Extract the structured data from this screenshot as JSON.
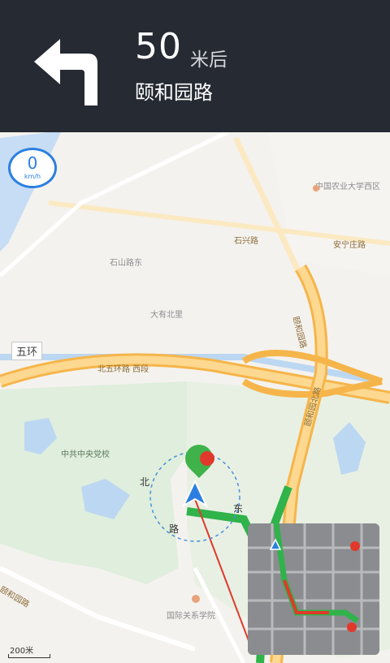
{
  "nav": {
    "distance": "50",
    "distance_unit": "米后",
    "road_name": "颐和园路",
    "turn_direction": "left-turn-icon"
  },
  "speed": {
    "value": "0",
    "unit": "km/h"
  },
  "map": {
    "ring_label": "五环",
    "labels": {
      "top_right_poi": "中国农业大学西区",
      "area1": "石山路东",
      "area2": "大有北里",
      "road_fifth_ring": "北五环路 西段",
      "road_right_vertical": "颐和园路",
      "road_right_vertical2": "颐和园北路",
      "park": "中共中央党校",
      "route_label_left": "北",
      "route_label_right": "东",
      "route_label_bottom": "路",
      "bottom_poi": "国际关系学院",
      "bottom_left_road": "颐和园路",
      "road_top": "石兴路",
      "right_road": "安宁庄路"
    },
    "scale": "200米"
  },
  "colors": {
    "header_bg": "#252a33",
    "accent_blue": "#2c7fe0",
    "route_green": "#2fb34a",
    "route_red": "#e0392b",
    "road_orange": "#f6b54a"
  }
}
